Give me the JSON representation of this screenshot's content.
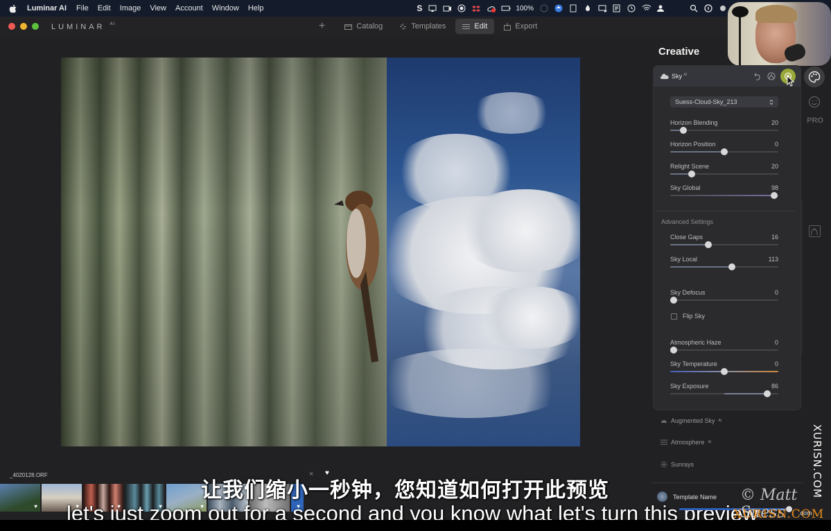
{
  "menubar": {
    "app_name": "Luminar AI",
    "items": [
      "File",
      "Edit",
      "Image",
      "View",
      "Account",
      "Window",
      "Help"
    ],
    "battery": "100%",
    "tray_icons": [
      "skype-icon",
      "airplay-icon",
      "camera-icon",
      "record-icon",
      "dropbox-icon",
      "creative-cloud-icon",
      "battery-icon",
      "app-icon",
      "upload-icon",
      "evernote-icon",
      "flame-icon",
      "display-icon",
      "notes-icon",
      "time-machine-icon",
      "wifi-icon",
      "user-icon",
      "search-icon",
      "info-icon",
      "control-center-icon"
    ]
  },
  "titlebar": {
    "logo": "LUMINAR",
    "logo_sup": "AI",
    "tabs": [
      {
        "label": "Catalog",
        "icon": "folder-icon",
        "active": false
      },
      {
        "label": "Templates",
        "icon": "sparkle-icon",
        "active": false
      },
      {
        "label": "Edit",
        "icon": "sliders-icon",
        "active": true
      },
      {
        "label": "Export",
        "icon": "share-icon",
        "active": false
      }
    ]
  },
  "filmstrip": {
    "filename": "_4020128.ORF",
    "thumbnails": 8
  },
  "subtitles": {
    "chinese": "让我们缩小一秒钟，您知道如何打开此预览",
    "english": "let's just zoom out for a second and you know what let's turn this preview"
  },
  "panel": {
    "section_title": "Creative",
    "tool": {
      "name": "Sky",
      "badge": "AI",
      "sky_preset": "Suess-Cloud-Sky_213",
      "sliders": [
        {
          "label": "Horizon Blending",
          "value": "20",
          "position": 0.12
        },
        {
          "label": "Horizon Position",
          "value": "0",
          "position": 0.5
        },
        {
          "label": "Relight Scene",
          "value": "20",
          "position": 0.2
        },
        {
          "label": "Sky Global",
          "value": "98",
          "position": 0.96
        }
      ],
      "advanced_label": "Advanced Settings",
      "advanced_sliders": [
        {
          "label": "Close Gaps",
          "value": "16",
          "position": 0.35
        },
        {
          "label": "Sky Local",
          "value": "113",
          "position": 0.57
        }
      ],
      "defocus": {
        "label": "Sky Defocus",
        "value": "0",
        "position": 0.03
      },
      "flip_sky": {
        "label": "Flip Sky",
        "checked": false
      },
      "lower_sliders": [
        {
          "label": "Atmospheric Haze",
          "value": "0",
          "position": 0.03
        },
        {
          "label": "Sky Temperature",
          "value": "0",
          "position": 0.5
        },
        {
          "label": "Sky Exposure",
          "value": "86",
          "position": 0.9
        }
      ]
    },
    "other_tools": [
      {
        "label": "Augmented Sky",
        "badge": "AI",
        "icon": "augmented-sky-icon"
      },
      {
        "label": "Atmosphere",
        "badge": "AI",
        "icon": "atmosphere-icon"
      },
      {
        "label": "Sunrays",
        "badge": "",
        "icon": "sunrays-icon"
      }
    ],
    "template_name": "Template Name",
    "side_icons": [
      "palette-icon",
      "smiley-icon",
      "pro-label",
      "portrait-icon"
    ],
    "pro_label": "PRO"
  },
  "watermarks": {
    "vertical": "XURISN.COM",
    "signature": "© Matt Suess",
    "signature_suffix": ".com",
    "site": "XURISN.COM"
  },
  "colors": {
    "accent_highlight": "#9aa83a",
    "template_bar": "#2d5fb8"
  }
}
